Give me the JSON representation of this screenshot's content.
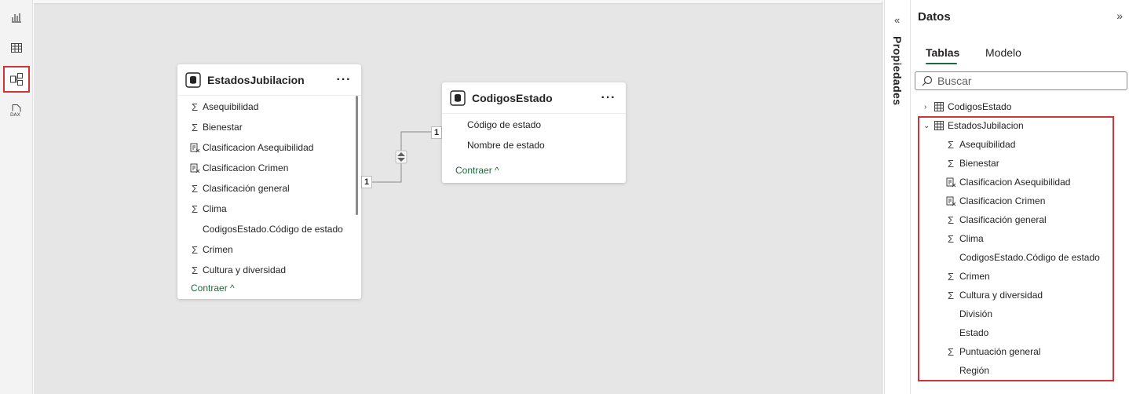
{
  "rail": {
    "items": [
      {
        "icon": "report-view-icon"
      },
      {
        "icon": "table-view-icon"
      },
      {
        "icon": "model-view-icon",
        "active": true
      },
      {
        "icon": "dax-query-view-icon"
      }
    ]
  },
  "model": {
    "table1": {
      "title": "EstadosJubilacion",
      "more": "···",
      "fields": [
        {
          "label": "Asequibilidad",
          "icon": "sigma"
        },
        {
          "label": "Bienestar",
          "icon": "sigma"
        },
        {
          "label": "Clasificacion Asequibilidad",
          "icon": "calc"
        },
        {
          "label": "Clasificacion Crimen",
          "icon": "calc"
        },
        {
          "label": "Clasificación general",
          "icon": "sigma"
        },
        {
          "label": "Clima",
          "icon": "sigma"
        },
        {
          "label": "CodigosEstado.Código de estado",
          "icon": "none"
        },
        {
          "label": "Crimen",
          "icon": "sigma"
        },
        {
          "label": "Cultura y diversidad",
          "icon": "sigma"
        }
      ],
      "collapse": "Contraer ^"
    },
    "table2": {
      "title": "CodigosEstado",
      "more": "···",
      "fields": [
        {
          "label": "Código de estado",
          "icon": "none"
        },
        {
          "label": "Nombre de estado",
          "icon": "none"
        }
      ],
      "collapse": "Contraer ^"
    },
    "relationship": {
      "from_cardinality": "1",
      "to_cardinality": "1"
    }
  },
  "properties": {
    "label": "Propiedades",
    "chevron": "«"
  },
  "data_pane": {
    "title": "Datos",
    "chevron": "»",
    "tabs": [
      {
        "label": "Tablas",
        "active": true
      },
      {
        "label": "Modelo",
        "active": false
      }
    ],
    "search_placeholder": "Buscar",
    "tables": [
      {
        "label": "CodigosEstado",
        "expanded": false
      },
      {
        "label": "EstadosJubilacion",
        "expanded": true
      }
    ],
    "fields": [
      {
        "label": "Asequibilidad",
        "icon": "sigma"
      },
      {
        "label": "Bienestar",
        "icon": "sigma"
      },
      {
        "label": "Clasificacion Asequibilidad",
        "icon": "calc"
      },
      {
        "label": "Clasificacion Crimen",
        "icon": "calc"
      },
      {
        "label": "Clasificación general",
        "icon": "sigma"
      },
      {
        "label": "Clima",
        "icon": "sigma"
      },
      {
        "label": "CodigosEstado.Código de estado",
        "icon": "none"
      },
      {
        "label": "Crimen",
        "icon": "sigma"
      },
      {
        "label": "Cultura y diversidad",
        "icon": "sigma"
      },
      {
        "label": "División",
        "icon": "none"
      },
      {
        "label": "Estado",
        "icon": "none"
      },
      {
        "label": "Puntuación general",
        "icon": "sigma"
      },
      {
        "label": "Región",
        "icon": "none"
      }
    ]
  },
  "colors": {
    "accent": "#1a6b3d",
    "highlight": "#d13438",
    "canvas": "#e6e6e6"
  }
}
